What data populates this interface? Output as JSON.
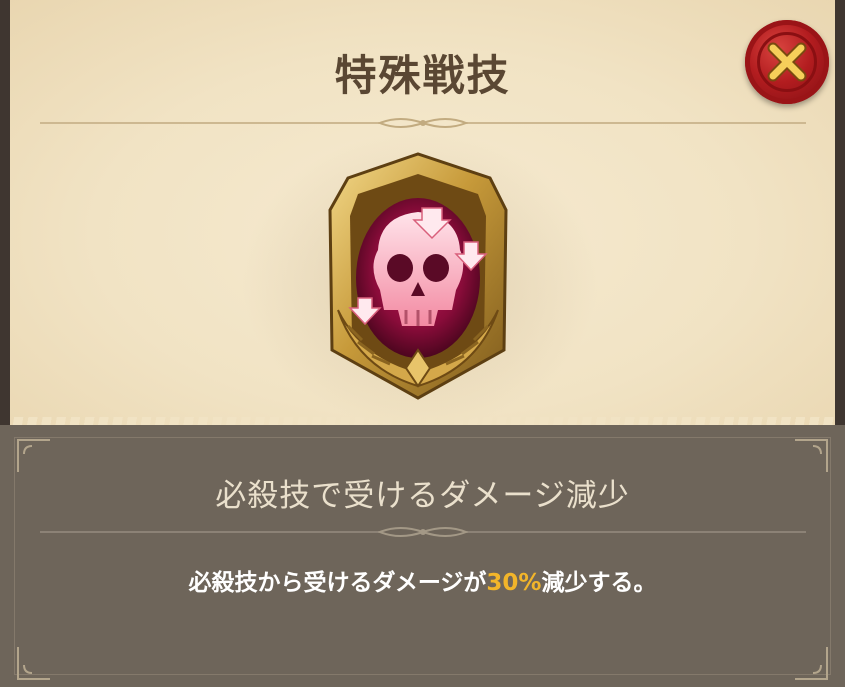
{
  "dialog": {
    "title": "特殊戦技",
    "close_icon": "close-x-icon",
    "skill_icon": "skull-debuff-icon",
    "skill_name": "必殺技で受けるダメージ減少",
    "description_before": "必殺技から受けるダメージが",
    "description_value": "30%",
    "description_after": "減少する。"
  },
  "colors": {
    "parchment": "#f1e3c4",
    "panel": "#6e655a",
    "title_text": "#5a4733",
    "accent_value": "#f2b52a",
    "close_red": "#b21c1f",
    "gold": "#c79a3a",
    "gem_magenta": "#8a0c3a"
  }
}
